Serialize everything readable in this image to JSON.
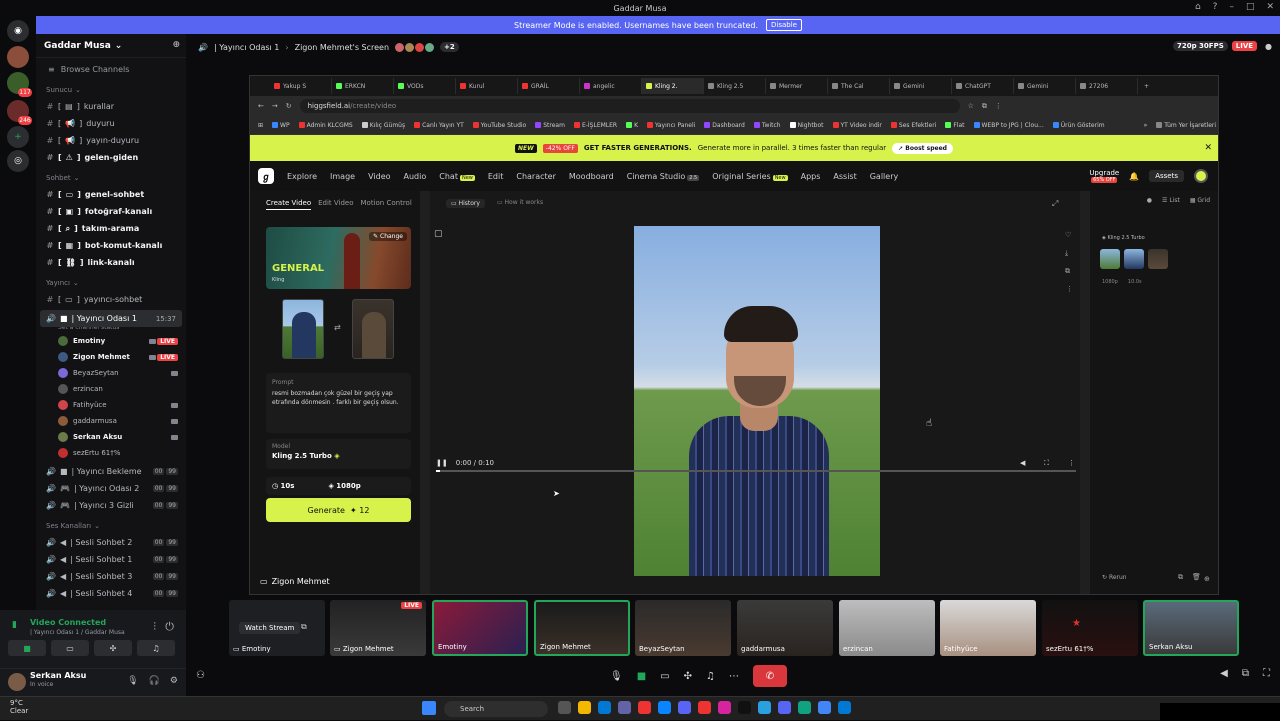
{
  "window": {
    "title": "Gaddar Musa"
  },
  "banner": {
    "text": "Streamer Mode is enabled. Usernames have been truncated.",
    "action": "Disable"
  },
  "rail": {
    "badges": [
      "117",
      "246"
    ]
  },
  "server": {
    "name": "Gaddar Musa",
    "browse": "Browse Channels"
  },
  "sidebar": {
    "categories": {
      "sunucu": "Sunucu",
      "sohbet": "Sohbet",
      "yayinci": "Yayıncı",
      "ses": "Ses Kanalları"
    },
    "channels_sunucu": [
      "kurallar",
      "duyuru",
      "yayın-duyuru",
      "gelen-giden"
    ],
    "channels_sohbet": [
      "genel-sohbet",
      "fotoğraf-kanalı",
      "takım-arama",
      "bot-komut-kanalı",
      "link-kanalı"
    ],
    "channels_yayinci": [
      "yayıncı-sohbet"
    ],
    "active_voice": {
      "name": "| Yayıncı Odası 1",
      "time": "15:37",
      "status": "Set a channel status"
    },
    "voice_users": [
      "Emotiny",
      "Zigon Mehmet",
      "BeyazSeytan",
      "erzincan",
      "Fatihyüce",
      "gaddarmusa",
      "Serkan Aksu",
      "sezErtu 61†%"
    ],
    "live_label": "LIVE",
    "voice_channels": [
      "| Yayıncı Bekleme",
      "| Yayıncı Odası 2",
      "| Yayıncı 3 Gizli"
    ],
    "ses_channels": [
      "| Sesli Sohbet 2",
      "| Sesli Sohbet 1",
      "| Sesli Sohbet 3",
      "| Sesli Sohbet 4"
    ],
    "counts": [
      "00",
      "99"
    ]
  },
  "voice_status": {
    "title": "Video Connected",
    "sub": "| Yayıncı Odası 1 / Gaddar Musa"
  },
  "user_panel": {
    "name": "Serkan Aksu",
    "status": "In voice"
  },
  "topbar": {
    "channel": "| Yayıncı Odası 1",
    "screen": "Zigon Mehmet's Screen",
    "extra": "+2",
    "quality": "720p 30FPS",
    "live": "LIVE"
  },
  "browser": {
    "tabs": [
      "Yakup S",
      "ERKCN",
      "VODs",
      "Kurul",
      "GRAİL",
      "angelic",
      "Kling 2.",
      "Kling 2.5",
      "Mermer",
      "The Cal",
      "Gemini",
      "ChatGPT",
      "Gemini",
      "27206"
    ],
    "url_host": "higgsfield.ai",
    "url_path": "/create/video",
    "bookmarks": [
      "WP",
      "Admin KLCGMS",
      "Kılıç Gümüş",
      "Canlı Yayın YT",
      "YouTube Studio",
      "Stream",
      "E-İŞLEMLER",
      "K",
      "Yayıncı Paneli",
      "Dashboard",
      "Twitch",
      "Nightbot",
      "YT Video indir",
      "Ses Efektleri",
      "Flat",
      "WEBP to JPG | Clou...",
      "Ürün Gösterim"
    ],
    "all_bookmarks": "Tüm Yer İşaretleri"
  },
  "promo": {
    "new": "NEW",
    "discount": "-42% OFF",
    "headline": "GET FASTER GENERATIONS.",
    "text": "Generate more in parallel. 3 times faster than regular",
    "boost": "Boost speed"
  },
  "appnav": {
    "items": [
      "Explore",
      "Image",
      "Video",
      "Audio",
      "Chat",
      "Edit",
      "Character",
      "Moodboard",
      "Cinema Studio",
      "Original Series",
      "Apps",
      "Assist",
      "Gallery"
    ],
    "new_tag": "New",
    "cinema_tag": "2.5",
    "upgrade": "Upgrade",
    "upgrade_off": "65% OFF",
    "assets": "Assets"
  },
  "create": {
    "tabs": [
      "Create Video",
      "Edit Video",
      "Motion Control"
    ],
    "model_card": {
      "title": "GENERAL",
      "sub": "Kling",
      "change": "Change"
    },
    "prompt_label": "Prompt",
    "prompt_text": "resmi bozmadan çok güzel bir geçiş yap etrafında dönmesin . farklı bir geçiş olsun.",
    "model_label": "Model",
    "model_value": "Kling 2.5 Turbo",
    "duration": "10s",
    "resolution": "1080p",
    "generate": "Generate",
    "generate_cost": "12"
  },
  "center": {
    "tabs": [
      "History",
      "How it works"
    ],
    "time": "0:00 / 0:10",
    "progress": 0.0
  },
  "sidepanel": {
    "model": "Kling 2.5 Turbo",
    "meta": [
      "1080p",
      "10.0s"
    ],
    "view": [
      "List",
      "Grid"
    ],
    "rerun": "Rerun"
  },
  "share_label": "Zigon Mehmet",
  "strip": {
    "tiles": [
      "Emotiny",
      "Zigon Mehmet",
      "Emotiny",
      "Zigon Mehmet",
      "BeyazSeytan",
      "gaddarmusa",
      "erzincan",
      "Fatihyüce",
      "sezErtu 61†%",
      "Serkan Aksu"
    ],
    "watch_stream": "Watch Stream",
    "live": "LIVE"
  },
  "taskbar": {
    "temp": "9°C",
    "weather": "Clear",
    "search": "Search"
  }
}
